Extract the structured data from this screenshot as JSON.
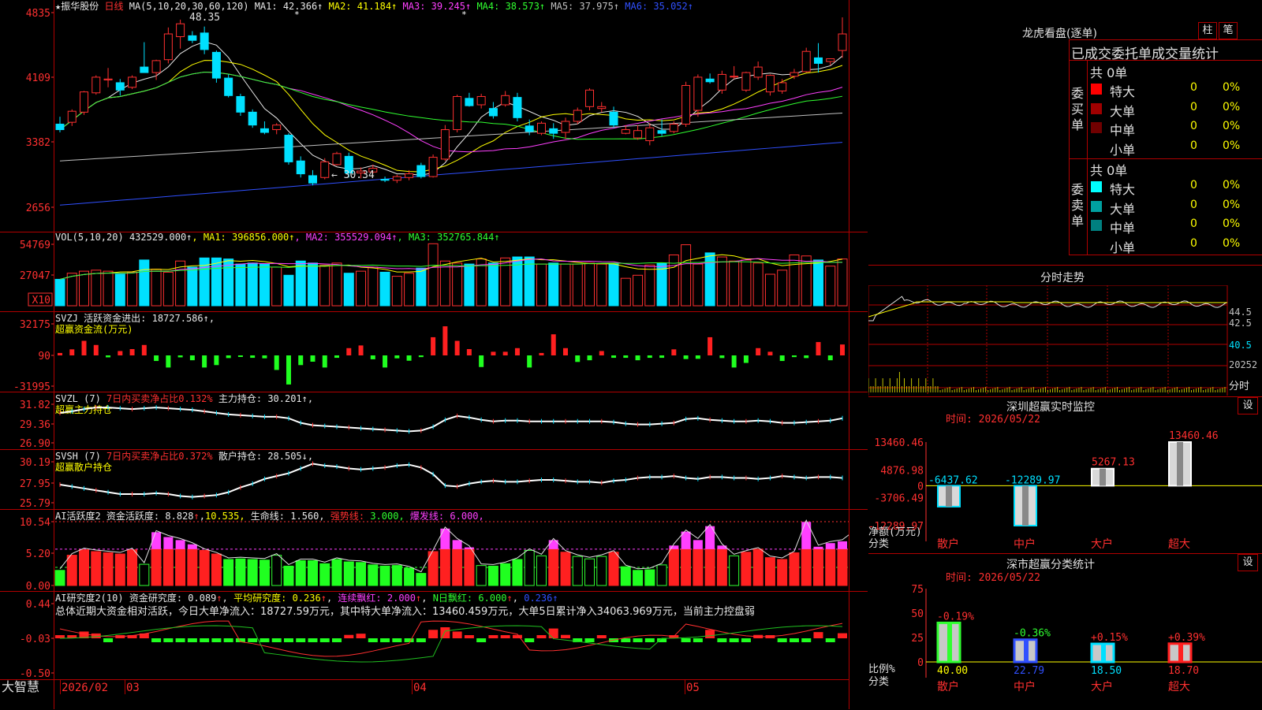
{
  "title": {
    "name": "振华股份",
    "period": "日线",
    "star": "★"
  },
  "price": {
    "ma_title": "MA(5,10,20,30,60,120)",
    "ma": [
      {
        "label": "MA1:",
        "value": "42.366↑",
        "color": "#e8e8e8"
      },
      {
        "label": "MA2:",
        "value": "41.184↑",
        "color": "#ffff00"
      },
      {
        "label": "MA3:",
        "value": "39.245↑",
        "color": "#ff40ff"
      },
      {
        "label": "MA4:",
        "value": "38.573↑",
        "color": "#30ff30"
      },
      {
        "label": "MA5:",
        "value": "37.975↑",
        "color": "#c0c0c0"
      },
      {
        "label": "MA6:",
        "value": "35.052↑",
        "color": "#3050ff"
      }
    ],
    "axis": [
      "4835",
      "4109",
      "3382",
      "2656"
    ],
    "high_note": "48.35",
    "low_note": "30.34",
    "candles": [
      [
        37.0,
        37.8,
        36.1,
        36.4
      ],
      [
        37.2,
        38.6,
        36.8,
        38.4
      ],
      [
        38.3,
        40.6,
        38.0,
        40.5
      ],
      [
        40.4,
        42.3,
        40.2,
        42.1
      ],
      [
        41.8,
        43.1,
        41.0,
        41.9
      ],
      [
        41.5,
        41.9,
        40.1,
        40.7
      ],
      [
        41.0,
        42.3,
        40.8,
        42.1
      ],
      [
        43.2,
        45.9,
        42.8,
        42.6
      ],
      [
        42.6,
        44.0,
        41.8,
        43.9
      ],
      [
        44.0,
        47.5,
        43.6,
        46.8
      ],
      [
        46.5,
        48.35,
        45.2,
        47.9
      ],
      [
        46.6,
        47.1,
        45.8,
        46.1
      ],
      [
        46.9,
        47.6,
        44.6,
        45.1
      ],
      [
        44.8,
        45.0,
        41.5,
        42.0
      ],
      [
        42.0,
        42.4,
        39.9,
        40.1
      ],
      [
        40.0,
        40.3,
        37.9,
        38.3
      ],
      [
        38.3,
        38.6,
        36.6,
        36.9
      ],
      [
        36.5,
        37.3,
        35.9,
        36.1
      ],
      [
        36.4,
        37.1,
        35.9,
        36.9
      ],
      [
        35.8,
        36.0,
        32.6,
        32.9
      ],
      [
        33.0,
        33.5,
        31.2,
        31.6
      ],
      [
        31.4,
        32.0,
        30.34,
        30.6
      ],
      [
        31.2,
        33.3,
        31.0,
        32.9
      ],
      [
        32.6,
        34.0,
        32.5,
        33.8
      ],
      [
        33.5,
        33.9,
        31.2,
        31.7
      ],
      [
        31.7,
        32.3,
        31.1,
        31.9
      ],
      [
        31.8,
        32.6,
        31.6,
        32.2
      ],
      [
        31.0,
        31.3,
        30.7,
        30.9
      ],
      [
        30.9,
        31.5,
        30.6,
        31.3
      ],
      [
        31.2,
        32.0,
        30.9,
        31.6
      ],
      [
        32.5,
        32.8,
        31.1,
        31.3
      ],
      [
        31.3,
        33.7,
        31.2,
        33.4
      ],
      [
        33.2,
        36.9,
        33.0,
        36.4
      ],
      [
        36.4,
        40.2,
        36.1,
        40.0
      ],
      [
        39.8,
        40.4,
        38.9,
        39.0
      ],
      [
        39.1,
        40.3,
        38.7,
        40.0
      ],
      [
        38.7,
        39.4,
        37.6,
        37.9
      ],
      [
        39.1,
        40.6,
        38.9,
        40.1
      ],
      [
        39.9,
        40.4,
        37.3,
        37.7
      ],
      [
        36.8,
        37.5,
        35.8,
        36.2
      ],
      [
        36.0,
        37.3,
        35.8,
        37.1
      ],
      [
        36.5,
        37.1,
        35.4,
        36.0
      ],
      [
        36.1,
        37.7,
        35.4,
        37.3
      ],
      [
        37.3,
        38.8,
        37.0,
        38.5
      ],
      [
        38.9,
        40.9,
        38.5,
        40.7
      ],
      [
        38.7,
        39.4,
        38.3,
        38.9
      ],
      [
        38.3,
        38.9,
        36.6,
        36.9
      ],
      [
        36.0,
        36.9,
        35.9,
        36.4
      ],
      [
        35.5,
        36.9,
        35.3,
        36.3
      ],
      [
        35.2,
        37.1,
        34.7,
        36.6
      ],
      [
        36.3,
        37.5,
        35.7,
        36.0
      ],
      [
        36.2,
        37.3,
        36.0,
        37.0
      ],
      [
        37.0,
        41.6,
        36.7,
        41.2
      ],
      [
        38.5,
        42.4,
        37.8,
        42.1
      ],
      [
        41.9,
        42.5,
        41.4,
        41.6
      ],
      [
        40.7,
        42.8,
        40.3,
        42.4
      ],
      [
        42.2,
        43.3,
        41.9,
        42.2
      ],
      [
        40.7,
        42.7,
        40.5,
        42.6
      ],
      [
        42.1,
        43.8,
        41.8,
        43.2
      ],
      [
        40.5,
        42.4,
        40.1,
        42.3
      ],
      [
        40.6,
        41.9,
        40.3,
        41.5
      ],
      [
        42.2,
        43.0,
        41.9,
        42.6
      ],
      [
        42.7,
        45.3,
        42.6,
        44.9
      ],
      [
        44.2,
        45.8,
        42.6,
        43.6
      ],
      [
        43.8,
        44.1,
        43.4,
        44.1
      ],
      [
        45.0,
        48.6,
        44.2,
        46.8
      ]
    ]
  },
  "vol": {
    "title": "VOL(5,10,20)",
    "value": "432529.000↑",
    "ma": [
      {
        "label": "MA1:",
        "value": "396856.000↑",
        "color": "#ffff00"
      },
      {
        "label": "MA2:",
        "value": "355529.094↑",
        "color": "#ff40ff"
      },
      {
        "label": "MA3:",
        "value": "352765.844↑",
        "color": "#30ff30"
      }
    ],
    "axis": [
      "54769",
      "27047"
    ],
    "unit": "X10",
    "bars": [
      260000,
      320000,
      340000,
      350000,
      340000,
      310000,
      330000,
      450000,
      360000,
      330000,
      440000,
      380000,
      470000,
      470000,
      460000,
      410000,
      420000,
      410000,
      380000,
      300000,
      440000,
      420000,
      400000,
      420000,
      320000,
      340000,
      380000,
      330000,
      290000,
      320000,
      370000,
      610000,
      440000,
      420000,
      410000,
      460000,
      420000,
      470000,
      480000,
      480000,
      410000,
      420000,
      410000,
      410000,
      420000,
      410000,
      410000,
      270000,
      300000,
      400000,
      420000,
      500000,
      600000,
      410000,
      520000,
      480000,
      440000,
      450000,
      420000,
      310000,
      350000,
      500000,
      490000,
      450000,
      390000,
      460000
    ]
  },
  "svzj": {
    "title": "SVZJ",
    "desc": "活跃资金进出:",
    "value": "18727.586↑,",
    "sub": "超赢资金流(万元)",
    "axis": [
      "32175",
      "90",
      "-31995"
    ],
    "bars": [
      1000,
      2500,
      6000,
      4300,
      -800,
      1800,
      2600,
      4300,
      -2300,
      -5000,
      -800,
      -2000,
      -5000,
      -4000,
      -1100,
      -500,
      -1000,
      -1200,
      -6000,
      -12000,
      -4000,
      -2600,
      -5000,
      -1000,
      3000,
      4100,
      -1600,
      -5000,
      -1200,
      -2200,
      -700,
      7500,
      12000,
      6000,
      2600,
      -4800,
      1500,
      1500,
      3000,
      -5000,
      1000,
      8700,
      3000,
      -2700,
      -2000,
      1800,
      -1000,
      -1000,
      -2000,
      -1000,
      -1000,
      2500,
      -1500,
      -1400,
      7500,
      -1100,
      -5000,
      -3100,
      3000,
      1500,
      -2300,
      -700,
      -1100,
      5500,
      -2000,
      4500,
      7800
    ]
  },
  "svzl": {
    "title": "SVZL (7)",
    "desc": "7日内买卖净占比0.132%",
    "hold": "主力持仓:",
    "value": "30.201↑,",
    "sub": "超赢主力持仓",
    "axis": [
      "31.82",
      "29.36",
      "26.90"
    ]
  },
  "svsh": {
    "title": "SVSH (7)",
    "desc": "7日内买卖净占比0.372%",
    "hold": "散户持仓:",
    "value": "28.505↓,",
    "sub": "超赢散户持仓",
    "axis": [
      "30.19",
      "27.95",
      "25.79"
    ]
  },
  "ai1": {
    "title": "AI活跃度2",
    "desc": "资金活跃度:",
    "value": "8.828",
    "v2": "10.535,",
    "life": "生命线:",
    "life_value": "1.560,",
    "strong": "强势线:",
    "strong_value": "3.000,",
    "burst": "爆发线:",
    "burst_value": "6.000,",
    "axis": [
      "10.54",
      "5.20",
      "0.00"
    ],
    "values": [
      2.5,
      5.0,
      5.9,
      5.6,
      5.4,
      5.2,
      5.9,
      3.5,
      8.8,
      8.0,
      7.5,
      6.8,
      5.8,
      5.2,
      4.3,
      4.4,
      4.3,
      4.2,
      5.0,
      3.2,
      4.1,
      4.1,
      3.6,
      4.3,
      3.9,
      3.8,
      3.4,
      3.2,
      3.3,
      2.9,
      2.0,
      5.6,
      9.4,
      7.5,
      6.3,
      3.3,
      3.2,
      3.6,
      4.3,
      5.8,
      4.9,
      7.5,
      5.5,
      4.8,
      4.4,
      4.8,
      5.5,
      3.1,
      2.5,
      2.6,
      3.4,
      6.6,
      8.9,
      7.5,
      9.8,
      6.6,
      4.9,
      5.5,
      6.0,
      4.6,
      4.3,
      5.4,
      10.5,
      6.4,
      7.0,
      7.3,
      8.8
    ],
    "colors": [
      "g",
      "r",
      "r",
      "r",
      "r",
      "r",
      "r",
      "h",
      "r",
      "r",
      "r",
      "r",
      "r",
      "r",
      "g",
      "g",
      "g",
      "g",
      "h",
      "g",
      "g",
      "g",
      "g",
      "g",
      "g",
      "g",
      "g",
      "g",
      "g",
      "g",
      "g",
      "r",
      "r",
      "r",
      "r",
      "h",
      "g",
      "g",
      "g",
      "h",
      "h",
      "r",
      "r",
      "h",
      "h",
      "h",
      "r",
      "g",
      "g",
      "g",
      "h",
      "r",
      "r",
      "r",
      "r",
      "r",
      "h",
      "r",
      "r",
      "r",
      "r",
      "r",
      "r",
      "r",
      "r",
      "r",
      "r"
    ]
  },
  "ai2": {
    "title": "AI研究度2(10)",
    "desc": "资金研究度:",
    "value": "0.089",
    "avg": "平均研究度:",
    "avg_value": "0.236",
    "cont": "连续飘红:",
    "cont_value": "2.000",
    "nday": "N日飘红:",
    "nday_value": "6.000",
    "extra": "0.236↑",
    "summary": "总体近期大资金相对活跃，今日大单净流入：18727.59万元，其中特大单净流入：13460.459万元，大单5日累计净入34063.969万元，当前主力控盘弱",
    "axis": [
      "0.44",
      "-0.03",
      "-0.50"
    ]
  },
  "dates": {
    "brand": "大智慧",
    "labels": [
      "2026/02",
      "03",
      "04",
      "05"
    ]
  },
  "right": {
    "dragon": {
      "title": "龙虎看盘(逐单)",
      "btn1": "柱",
      "btn2": "笔",
      "header": "已成交委托单成交量统计",
      "buy_label": "委买单",
      "sell_label": "委卖单",
      "buy_total": "共 0单",
      "sell_total": "共 0单",
      "buy_rows": [
        {
          "name": "特大",
          "count": "0",
          "pct": "0%",
          "color": "#ff0000"
        },
        {
          "name": "大单",
          "count": "0",
          "pct": "0%",
          "color": "#a00000"
        },
        {
          "name": "中单",
          "count": "0",
          "pct": "0%",
          "color": "#700000"
        },
        {
          "name": "小单",
          "count": "0",
          "pct": "0%",
          "color": ""
        }
      ],
      "sell_rows": [
        {
          "name": "特大",
          "count": "0",
          "pct": "0%",
          "color": "#00ffff"
        },
        {
          "name": "大单",
          "count": "0",
          "pct": "0%",
          "color": "#00a0a0"
        },
        {
          "name": "中单",
          "count": "0",
          "pct": "0%",
          "color": "#008080"
        },
        {
          "name": "小单",
          "count": "0",
          "pct": "0%",
          "color": ""
        }
      ]
    },
    "fenshi": {
      "title": "分时走势",
      "axis": [
        "44.5",
        "42.5",
        "40.5",
        "20252"
      ],
      "axis_last": "分时"
    },
    "sz_monitor": {
      "title": "深圳超赢实时监控",
      "btn": "设",
      "time": "时间: 2026/05/22",
      "axis": [
        "13460.46",
        "4876.98",
        "0",
        "-3706.49",
        "-12289.97"
      ],
      "ylabel": "净额(万元)",
      "xlabel": "分类",
      "categories": [
        "散户",
        "中户",
        "大户",
        "超大"
      ],
      "values": [
        -6437.62,
        -12289.97,
        5267.13,
        13460.46
      ],
      "labels": [
        "-6437.62",
        "-12289.97",
        "5267.13",
        "13460.46"
      ]
    },
    "sz_stats": {
      "title": "深市超赢分类统计",
      "btn": "设",
      "time": "时间: 2026/05/22",
      "axis": [
        "75",
        "50",
        "25",
        "0"
      ],
      "ylabel": "比例%",
      "xlabel": "分类",
      "categories": [
        "散户",
        "中户",
        "大户",
        "超大"
      ],
      "values": [
        40.0,
        22.79,
        18.5,
        18.7
      ],
      "value_labels": [
        "40.00",
        "22.79",
        "18.50",
        "18.70"
      ],
      "change_labels": [
        "-0.19%",
        "-0.36%",
        "+0.15%",
        "+0.39%"
      ]
    }
  },
  "chart_data": [
    {
      "type": "bar",
      "title": "深圳超赢实时监控",
      "categories": [
        "散户",
        "中户",
        "大户",
        "超大"
      ],
      "values": [
        -6437.62,
        -12289.97,
        5267.13,
        13460.46
      ],
      "ylabel": "净额(万元)",
      "xlabel": "分类",
      "ylim": [
        -12289.97,
        13460.46
      ]
    },
    {
      "type": "bar",
      "title": "深市超赢分类统计",
      "categories": [
        "散户",
        "中户",
        "大户",
        "超大"
      ],
      "values": [
        40.0,
        22.79,
        18.5,
        18.7
      ],
      "ylabel": "比例%",
      "xlabel": "分类",
      "ylim": [
        0,
        75
      ]
    }
  ]
}
